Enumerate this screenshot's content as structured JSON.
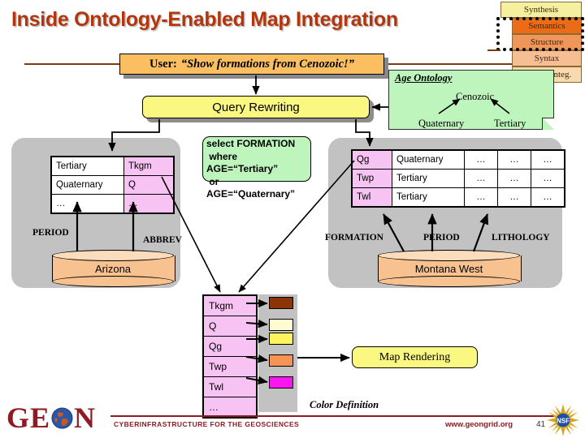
{
  "title": "Inside Ontology-Enabled Map Integration",
  "user_banner": {
    "label": "User:",
    "quote": "“Show formations from Cenozoic!”"
  },
  "query_rewriting": {
    "label": "Query Rewriting"
  },
  "maturity_stack": {
    "rows": [
      {
        "label": "Synthesis",
        "color": "#F5EFA0"
      },
      {
        "label": "Semantics",
        "color": "#EC6B16"
      },
      {
        "label": "Structure",
        "color": "#F0965A"
      },
      {
        "label": "Syntax",
        "color": "#F7BE93"
      },
      {
        "label": "System Integ.",
        "color": "#F9D9AE"
      }
    ]
  },
  "age_ontology": {
    "title": "Age Ontology",
    "root": "Cenozoic",
    "children": [
      "Quaternary",
      "Tertiary"
    ],
    "color": "#BDF5BC"
  },
  "sql_query": "select FORMATION\n where\nAGE=“Tertiary”\n or\nAGE=“Quaternary”",
  "left_source": {
    "db_name": "Arizona",
    "columns": [
      "PERIOD",
      "ABBREV"
    ],
    "rows": [
      [
        "Tertiary",
        "Tkgm"
      ],
      [
        "Quaternary",
        "Q"
      ],
      [
        "…",
        "…"
      ]
    ]
  },
  "right_source": {
    "db_name": "Montana West",
    "columns": [
      "FORMATION",
      "PERIOD",
      "LITHOLOGY"
    ],
    "rows": [
      [
        "Qg",
        "Quaternary",
        "…",
        "…",
        "…"
      ],
      [
        "Twp",
        "Tertiary",
        "…",
        "…",
        "…"
      ],
      [
        "Twl",
        "Tertiary",
        "…",
        "…",
        "…"
      ]
    ]
  },
  "legend": {
    "caption": "Color Definition",
    "entries": [
      {
        "code": "Tkgm",
        "color": "#8C3307"
      },
      {
        "code": "Q",
        "color": "#FCFBD2"
      },
      {
        "code": "Qg",
        "color": "#FBF45D"
      },
      {
        "code": "Twp",
        "color": "#F79354"
      },
      {
        "code": "Twl",
        "color": "#FB16F1"
      },
      {
        "code": "…",
        "color": null
      }
    ]
  },
  "map_rendering": {
    "label": "Map Rendering"
  },
  "footer": {
    "logo": "GEON",
    "tagline": "CYBERINFRASTRUCTURE FOR THE GEOSCIENCES",
    "url": "www.geongrid.org",
    "page": "41",
    "nsf_label": "NSF"
  },
  "colors": {
    "title": "#B2360D",
    "banner": "#FBBF62",
    "yellow_box": "#FBF881",
    "panel_gray": "#C2C2C2",
    "pink": "#F7C3F2",
    "cylinder": "#F8C290",
    "footer_red": "#8F1A22"
  }
}
